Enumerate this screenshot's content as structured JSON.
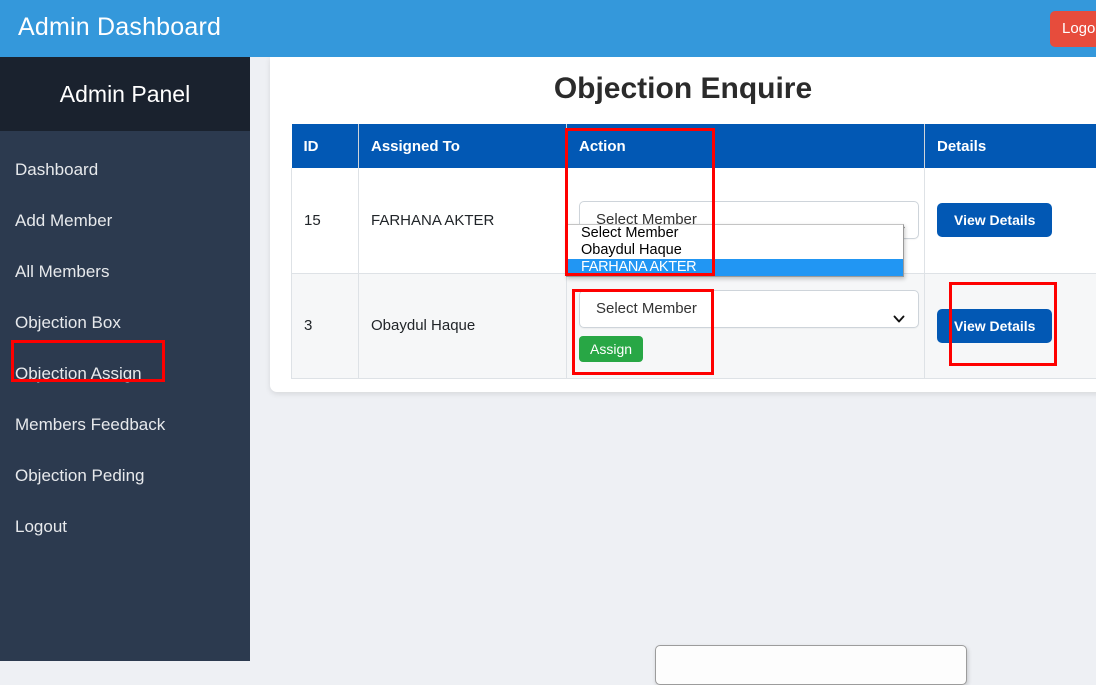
{
  "topbar": {
    "title": "Admin Dashboard",
    "logout_label": "Logout",
    "background": "#3498db",
    "logout_color": "#e74c3c"
  },
  "sidebar": {
    "header_title": "Admin Panel",
    "background": "#2c3a4f",
    "header_background": "#1a222e",
    "items": [
      {
        "label": "Dashboard"
      },
      {
        "label": "Add Member"
      },
      {
        "label": "All Members"
      },
      {
        "label": "Objection Box"
      },
      {
        "label": "Objection Assign"
      },
      {
        "label": "Members Feedback"
      },
      {
        "label": "Objection Peding"
      },
      {
        "label": "Logout"
      }
    ]
  },
  "main": {
    "page_title": "Objection Enquire",
    "table": {
      "header_background": "#0258b4",
      "columns": [
        "ID",
        "Assigned To",
        "Action",
        "",
        "Details"
      ],
      "rows": [
        {
          "id": "15",
          "assigned_to": "FARHANA AKTER",
          "select_value": "Select Member",
          "details_label": "View Details"
        },
        {
          "id": "3",
          "assigned_to": "Obaydul Haque",
          "select_value": "Select Member",
          "assign_label": "Assign",
          "details_label": "View Details"
        }
      ]
    },
    "dropdown": {
      "open": true,
      "options": [
        "Select Member",
        "Obaydul Haque",
        "FARHANA AKTER"
      ],
      "selected_index": 2,
      "highlight_color": "#2196f3"
    }
  },
  "annotations": {
    "color": "#fe0000",
    "boxes": [
      {
        "target": "sidebar-item-objection-assign"
      },
      {
        "target": "action-column-select"
      },
      {
        "target": "assign-control-group"
      },
      {
        "target": "view-details-button-row2"
      }
    ]
  }
}
